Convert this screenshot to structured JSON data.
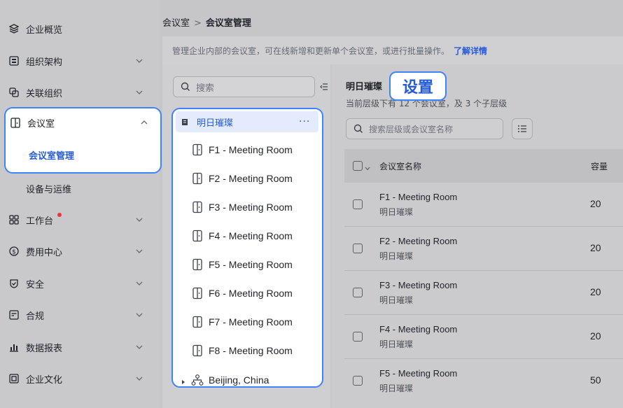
{
  "colors": {
    "accent": "#3f83f8",
    "link": "#245bdb",
    "badge_dot": "#e5383b"
  },
  "sidebar": {
    "items": [
      {
        "label": "企业概览",
        "icon": "layers-icon"
      },
      {
        "label": "组织架构",
        "icon": "org-icon"
      },
      {
        "label": "关联组织",
        "icon": "link-org-icon"
      },
      {
        "label": "会议室",
        "icon": "meeting-room-icon"
      },
      {
        "label": "会议室管理"
      },
      {
        "label": "设备与运维"
      },
      {
        "label": "工作台",
        "icon": "grid-icon"
      },
      {
        "label": "费用中心",
        "icon": "dollar-icon"
      },
      {
        "label": "安全",
        "icon": "shield-icon"
      },
      {
        "label": "合规",
        "icon": "compliance-icon"
      },
      {
        "label": "数据报表",
        "icon": "bar-chart-icon"
      },
      {
        "label": "企业文化",
        "icon": "culture-icon"
      }
    ]
  },
  "breadcrumb": {
    "parent": "会议室",
    "separator": ">",
    "current": "会议室管理"
  },
  "description": {
    "text": "管理企业内部的会议室，可在线新增和更新单个会议室，或进行批量操作。",
    "link": "了解详情"
  },
  "tree": {
    "search_placeholder": "搜索",
    "root": {
      "label": "明日璀璨",
      "more": "···"
    },
    "rooms": [
      "F1 - Meeting Room",
      "F2 - Meeting Room",
      "F3 - Meeting Room",
      "F4 - Meeting Room",
      "F5 - Meeting Room",
      "F6 - Meeting Room",
      "F7 - Meeting Room",
      "F8 - Meeting Room"
    ],
    "child_group": "Beijing, China"
  },
  "detail": {
    "title": "明日璀璨",
    "subtitle": "当前层级下有 12 个会议室，及 3 个子层级",
    "settings_badge": "设置",
    "search_placeholder": "搜索层级或会议室名称",
    "columns": {
      "name": "会议室名称",
      "capacity": "容量"
    },
    "rows": [
      {
        "name": "F1 - Meeting Room",
        "parent": "明日璀璨",
        "capacity": "20"
      },
      {
        "name": "F2 - Meeting Room",
        "parent": "明日璀璨",
        "capacity": "20"
      },
      {
        "name": "F3 - Meeting Room",
        "parent": "明日璀璨",
        "capacity": "20"
      },
      {
        "name": "F4 - Meeting Room",
        "parent": "明日璀璨",
        "capacity": "20"
      },
      {
        "name": "F5 - Meeting Room",
        "parent": "明日璀璨",
        "capacity": "50"
      }
    ]
  }
}
